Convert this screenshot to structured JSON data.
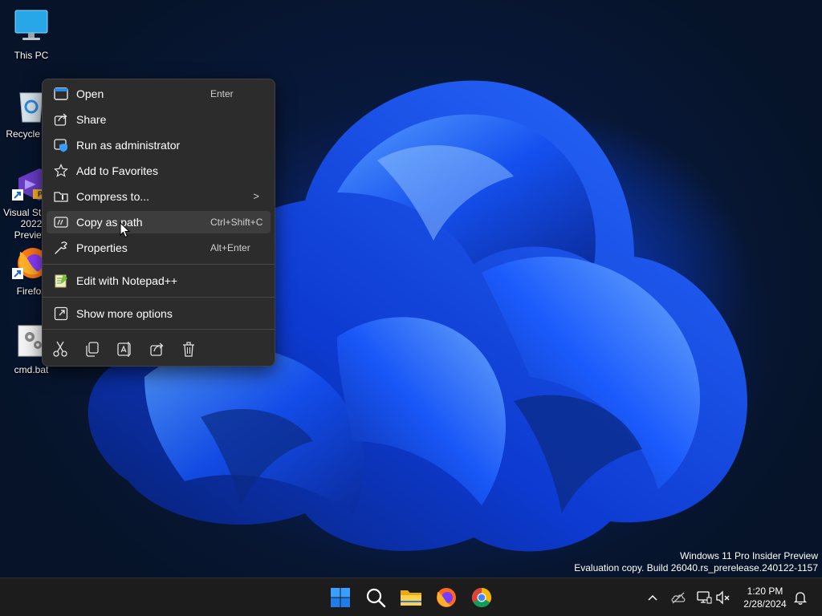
{
  "desktop_icons": [
    {
      "label": "This PC"
    },
    {
      "label": "Recycle Bin"
    },
    {
      "label": "Visual Studio 2022 Preview",
      "badge": "PRE"
    },
    {
      "label": "Firefox"
    },
    {
      "label": "cmd.bat"
    }
  ],
  "context_menu": {
    "items": [
      {
        "label": "Open",
        "shortcut": "Enter",
        "icon": "open-icon"
      },
      {
        "label": "Share",
        "shortcut": "",
        "icon": "share-icon"
      },
      {
        "label": "Run as administrator",
        "shortcut": "",
        "icon": "shield-icon"
      },
      {
        "label": "Add to Favorites",
        "shortcut": "",
        "icon": "star-icon"
      },
      {
        "label": "Compress to...",
        "shortcut": "",
        "icon": "zip-folder-icon",
        "submenu": true
      },
      {
        "label": "Copy as path",
        "shortcut": "Ctrl+Shift+C",
        "icon": "copy-path-icon",
        "highlighted": true
      },
      {
        "label": "Properties",
        "shortcut": "Alt+Enter",
        "icon": "wrench-icon"
      },
      {
        "label": "Edit with Notepad++",
        "shortcut": "",
        "icon": "notepadpp-icon"
      },
      {
        "label": "Show more options",
        "shortcut": "",
        "icon": "more-options-icon"
      }
    ],
    "quick_actions": [
      "cut-icon",
      "copy-icon",
      "rename-icon",
      "share-icon",
      "delete-icon"
    ],
    "chevron": ">"
  },
  "watermark": {
    "line1": "Windows 11 Pro Insider Preview",
    "line2": "Evaluation copy. Build 26040.rs_prerelease.240122-1157"
  },
  "taskbar": {
    "apps": [
      "start-icon",
      "search-icon",
      "file-explorer-icon",
      "firefox-icon",
      "chrome-icon"
    ],
    "tray": [
      "chevron-up-icon",
      "onedrive-icon",
      "network-icon",
      "speaker-muted-icon",
      "bell-icon"
    ],
    "time": "1:20 PM",
    "date": "2/28/2024"
  },
  "colors": {
    "menu_bg": "#2c2c2c",
    "menu_highlight": "#3d3d3d",
    "taskbar_bg": "#1c1c1c",
    "accent": "#0a5ce0"
  }
}
